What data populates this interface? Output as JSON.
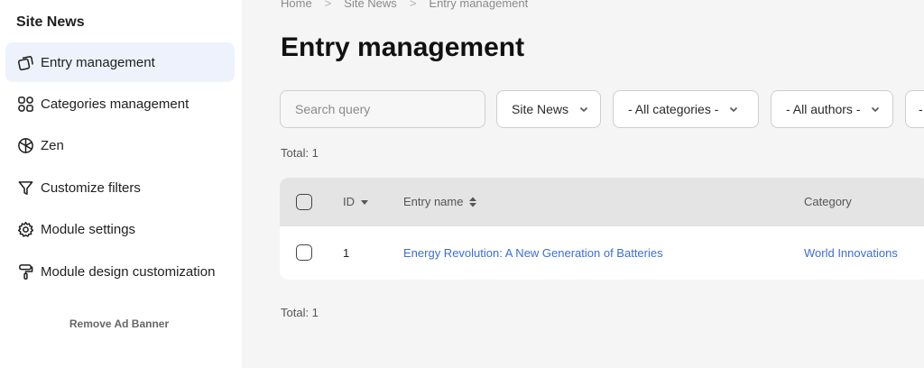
{
  "sidebar": {
    "title": "Site News",
    "items": [
      {
        "label": "Entry management",
        "icon": "copy-icon",
        "active": true
      },
      {
        "label": "Categories management",
        "icon": "grid-icon",
        "active": false
      },
      {
        "label": "Zen",
        "icon": "aperture-icon",
        "active": false
      },
      {
        "label": "Customize filters",
        "icon": "filter-icon",
        "active": false
      },
      {
        "label": "Module settings",
        "icon": "gear-icon",
        "active": false
      },
      {
        "label": "Module design customization",
        "icon": "paint-roller-icon",
        "active": false
      }
    ],
    "remove_ad": "Remove Ad Banner"
  },
  "breadcrumb": [
    "Home",
    "Site News",
    "Entry management"
  ],
  "breadcrumb_separator": ">",
  "page_title": "Entry management",
  "filters": {
    "search_placeholder": "Search query",
    "site": "Site News",
    "categories": "- All categories -",
    "authors": "- All authors -",
    "more": "-"
  },
  "total_top": "Total: 1",
  "total_bottom": "Total: 1",
  "table": {
    "columns": {
      "id": "ID",
      "name": "Entry name",
      "category": "Category"
    },
    "rows": [
      {
        "id": "1",
        "name": "Energy Revolution: A New Generation of Batteries",
        "category": "World Innovations"
      }
    ]
  },
  "colors": {
    "accent": "#3b6fd6",
    "active_bg": "#edf2fc",
    "header_bg": "#e4e4e4"
  }
}
